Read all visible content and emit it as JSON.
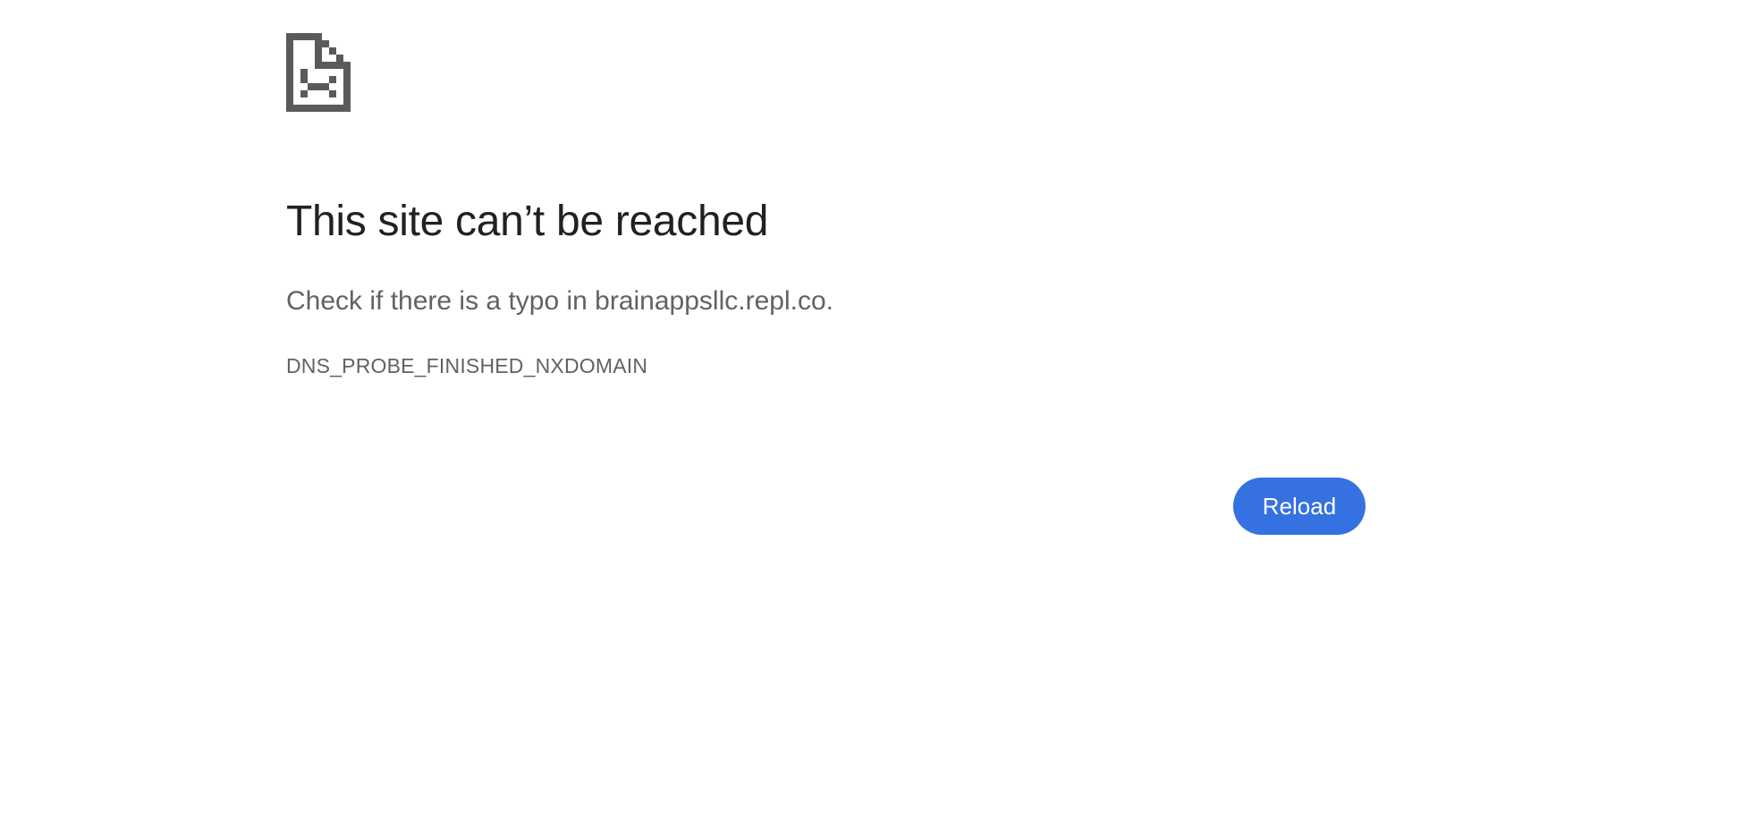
{
  "error_page": {
    "icon": "sad-page-icon",
    "title": "This site can’t be reached",
    "suggestion": "Check if there is a typo in brainappsllc.repl.co.",
    "error_code": "DNS_PROBE_FINISHED_NXDOMAIN",
    "reload_label": "Reload"
  },
  "colors": {
    "title": "#202124",
    "secondary_text": "#5f6368",
    "icon": "#5a5a5a",
    "button_bg": "#3571e0",
    "button_text": "#ffffff"
  }
}
